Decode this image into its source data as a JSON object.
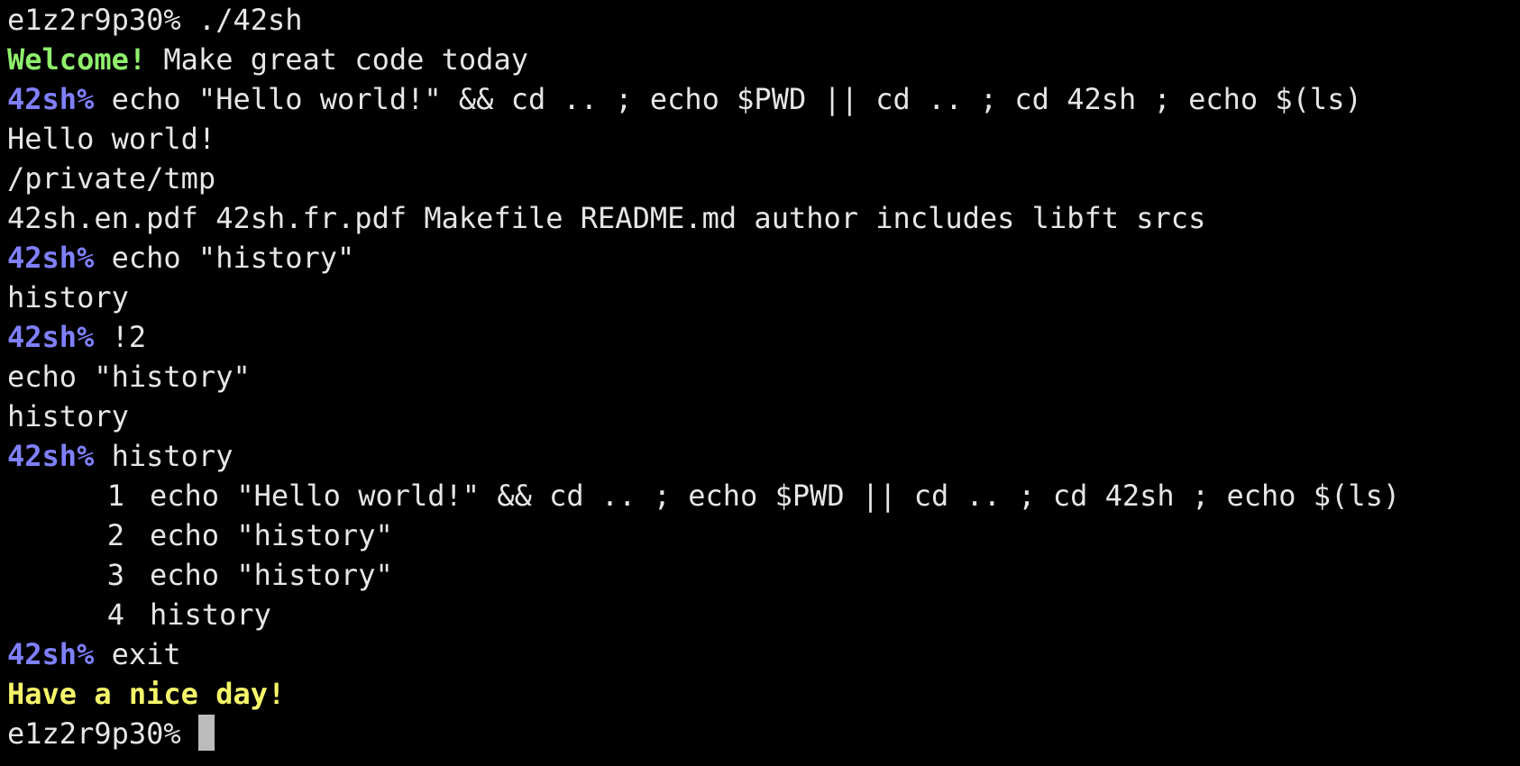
{
  "colors": {
    "background": "#000000",
    "text": "#e6e6e6",
    "welcome": "#8ff06c",
    "prompt": "#8080ff",
    "goodbye": "#f5f56a",
    "cursor": "#bcbcbc"
  },
  "terminal": {
    "system_prompt": "e1z2r9p30%",
    "launch_command": "./42sh",
    "welcome_bold": "Welcome!",
    "welcome_text": "Make great code today",
    "shell_prompt": "42sh%",
    "commands": [
      "echo \"Hello world!\" && cd .. ; echo $PWD || cd .. ; cd 42sh ; echo $(ls)",
      "echo \"history\"",
      "!2",
      "history",
      "exit"
    ],
    "outputs": {
      "hello": "Hello world!",
      "pwd": "/private/tmp",
      "ls": "42sh.en.pdf 42sh.fr.pdf Makefile README.md author includes libft srcs",
      "history_1": "history",
      "expanded": "echo \"history\"",
      "history_2": "history"
    },
    "history_list": [
      {
        "num": "1",
        "cmd": "echo \"Hello world!\" && cd .. ; echo $PWD || cd .. ; cd 42sh ; echo $(ls)"
      },
      {
        "num": "2",
        "cmd": "echo \"history\""
      },
      {
        "num": "3",
        "cmd": "echo \"history\""
      },
      {
        "num": "4",
        "cmd": "history"
      }
    ],
    "goodbye": "Have a nice day!"
  }
}
